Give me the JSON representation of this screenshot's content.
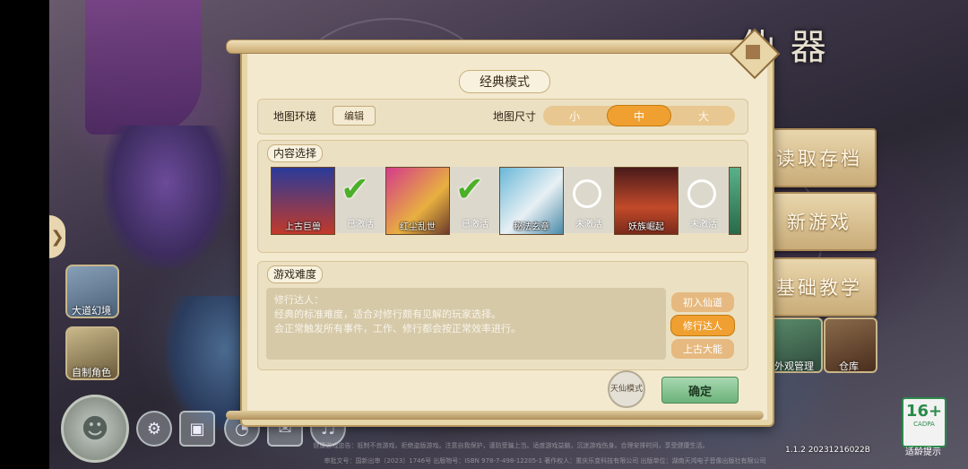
{
  "background": {
    "logo_text": "仙 器",
    "side_items": [
      {
        "label": "大道幻境"
      },
      {
        "label": "自制角色"
      }
    ],
    "menu": {
      "load_save": "读取存档",
      "new_game": "新游戏",
      "tutorial": "基础教学"
    },
    "small_tiles": [
      {
        "label": "外观管理"
      },
      {
        "label": "仓库"
      }
    ],
    "version": "1.1.2 20231216022B",
    "age_rating": {
      "number": "16+",
      "brand": "CADPA",
      "label": "适龄提示"
    },
    "footer_line1": "健康游戏忠告：抵制不良游戏，拒绝盗版游戏。注意自我保护，谨防受骗上当。适度游戏益脑，沉迷游戏伤身。合理安排时间，享受健康生活。",
    "footer_line2": "审批文号：国新出审〔2023〕1746号  出版物号：ISBN 978-7-498-12205-1  著作权人：重庆乐变科技有限公司  出版单位：湖南天鸿电子音像出版社有限公司"
  },
  "dialog": {
    "title": "经典模式",
    "map_env_label": "地图环境",
    "edit_button": "编辑",
    "map_size_label": "地图尺寸",
    "size_options": [
      "小",
      "中",
      "大"
    ],
    "size_selected": "中",
    "content_section": "内容选择",
    "content_items": [
      {
        "name": "上古巨兽",
        "status": "已激活",
        "active": true
      },
      {
        "name": "红尘乱世",
        "status": "已激活",
        "active": true
      },
      {
        "name": "秘法玄章",
        "status": "未激活",
        "active": false
      },
      {
        "name": "妖族崛起",
        "status": "未激活",
        "active": false
      }
    ],
    "difficulty_section": "游戏难度",
    "difficulty_desc": [
      "修行达人：",
      "经典的标准难度，适合对修行颇有见解的玩家选择。",
      "会正常触发所有事件，工作、修行都会按正常效率进行。"
    ],
    "difficulty_options": [
      "初入仙道",
      "修行达人",
      "上古大能"
    ],
    "difficulty_selected": "修行达人",
    "mode_badge": "天仙模式",
    "confirm": "确定"
  },
  "colors": {
    "panel_bg": "#f3e9cf",
    "accent_orange": "#f0a030",
    "confirm_green": "#6cb27a",
    "menu_gold": "#c9ac78"
  }
}
